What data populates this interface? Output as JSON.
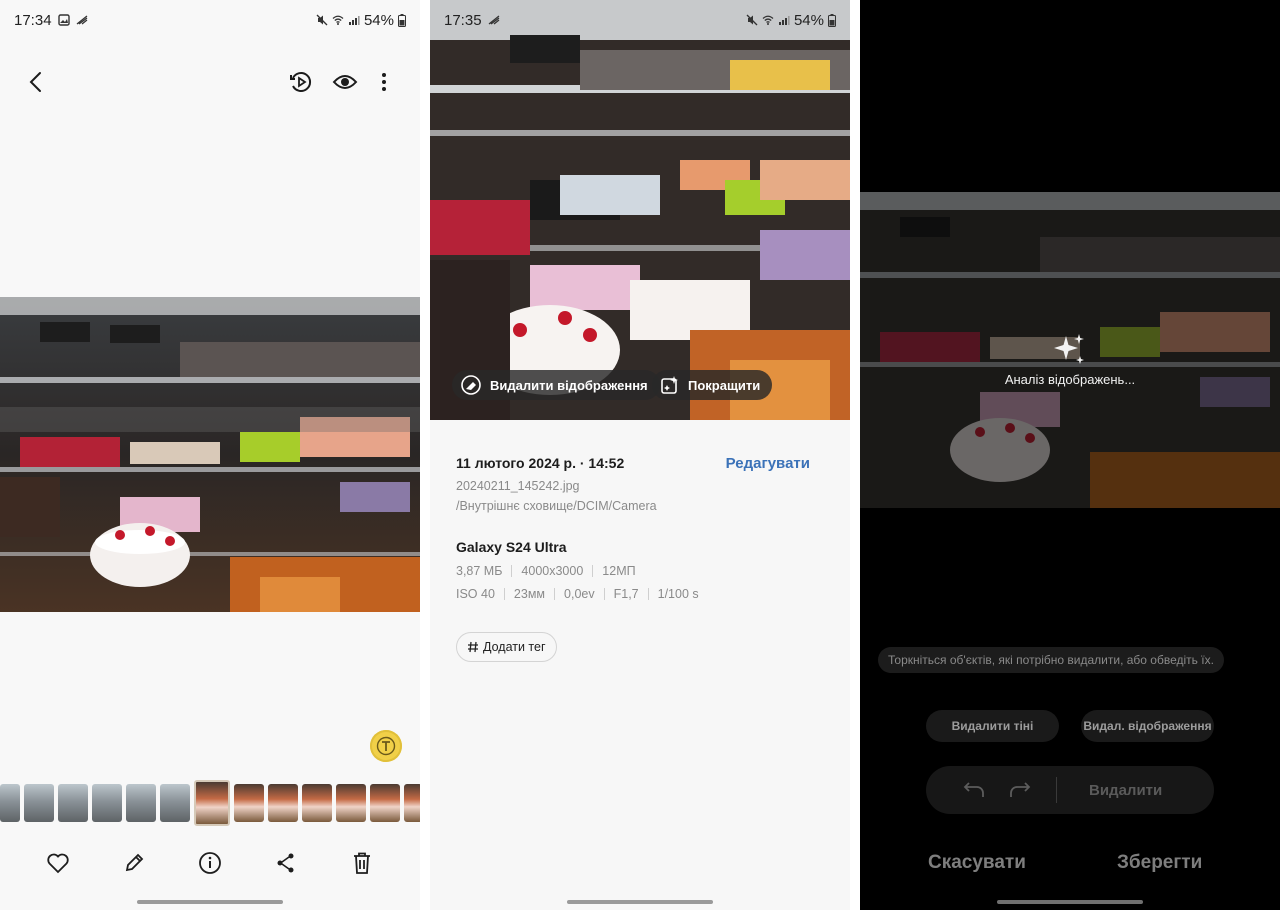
{
  "panel1": {
    "status": {
      "time": "17:34",
      "battery": "54%"
    },
    "toolbar_icons": [
      "back-icon",
      "motion-photo-icon",
      "eye-icon",
      "more-icon"
    ],
    "floating_icon": "text-extract-icon",
    "filmstrip": [
      "street",
      "street",
      "street",
      "street",
      "street",
      "street",
      "cake-selected",
      "cake",
      "cake",
      "cake",
      "cake",
      "cake",
      "cake"
    ],
    "bottom_icons": [
      "heart-icon",
      "pencil-icon",
      "info-icon",
      "share-icon",
      "trash-icon"
    ]
  },
  "panel2": {
    "status": {
      "time": "17:35",
      "battery": "54%"
    },
    "chips": {
      "remove_reflection": "Видалити відображення",
      "enhance": "Покращити"
    },
    "details": {
      "date": "11 лютого 2024 р. · 14:52",
      "edit": "Редагувати",
      "filename": "20240211_145242.jpg",
      "path": "/Внутрішнє сховище/DCIM/Camera",
      "device": "Galaxy S24 Ultra",
      "size": "3,87 МБ",
      "resolution": "4000x3000",
      "megapixels": "12МП",
      "iso": "ISO 40",
      "focal": "23мм",
      "ev": "0,0ev",
      "aperture": "F1,7",
      "shutter": "1/100 s",
      "add_tag": "Додати тег"
    }
  },
  "panel3": {
    "analyzing": "Аналіз відображень...",
    "hint": "Торкніться об'єктів, які потрібно видалити, або обведіть їх.",
    "remove_shadows": "Видалити тіні",
    "remove_reflections": "Видал. відображення",
    "delete": "Видалити",
    "cancel": "Скасувати",
    "save": "Зберегти"
  },
  "colors": {
    "accent": "#3b72b8",
    "dark_bg": "#000000",
    "light_bg": "#f8f8f8"
  }
}
